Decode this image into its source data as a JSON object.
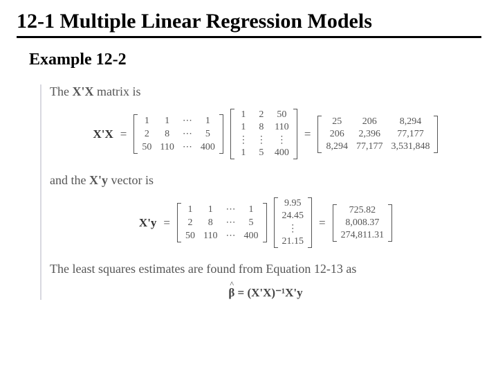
{
  "title": "12-1 Multiple Linear Regression Models",
  "subtitle": "Example 12-2",
  "text": {
    "line1_a": "The ",
    "line1_b": "X'X",
    "line1_c": " matrix is",
    "line2_a": "and the ",
    "line2_b": "X'y",
    "line2_c": " vector is",
    "line3": "The least squares estimates are found from Equation 12-13 as"
  },
  "eq1": {
    "lhs": "X'X",
    "A": [
      [
        "1",
        "1",
        "⋯",
        "1"
      ],
      [
        "2",
        "8",
        "⋯",
        "5"
      ],
      [
        "50",
        "110",
        "⋯",
        "400"
      ]
    ],
    "B": [
      [
        "1",
        "2",
        "50"
      ],
      [
        "1",
        "8",
        "110"
      ],
      [
        "⋮",
        "⋮",
        "⋮"
      ],
      [
        "1",
        "5",
        "400"
      ]
    ],
    "R": [
      [
        "25",
        "206",
        "8,294"
      ],
      [
        "206",
        "2,396",
        "77,177"
      ],
      [
        "8,294",
        "77,177",
        "3,531,848"
      ]
    ]
  },
  "eq2": {
    "lhs": "X'y",
    "A": [
      [
        "1",
        "1",
        "⋯",
        "1"
      ],
      [
        "2",
        "8",
        "⋯",
        "5"
      ],
      [
        "50",
        "110",
        "⋯",
        "400"
      ]
    ],
    "B": [
      [
        "9.95"
      ],
      [
        "24.45"
      ],
      [
        "⋮"
      ],
      [
        "21.15"
      ]
    ],
    "R": [
      [
        "725.82"
      ],
      [
        "8,008.37"
      ],
      [
        "274,811.31"
      ]
    ]
  },
  "final": {
    "beta": "β",
    "rhs": " = (X'X)⁻¹X'y"
  }
}
